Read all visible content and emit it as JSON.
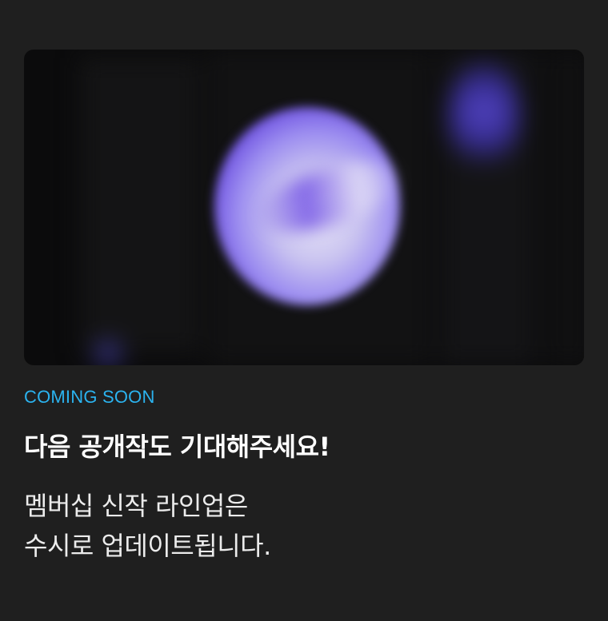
{
  "badge": {
    "label": "COMING SOON",
    "color": "#2bb3ef"
  },
  "headline": "다음 공개작도 기대해주세요!",
  "description": {
    "line1": "멤버십 신작 라인업은",
    "line2": "수시로 업데이트됩니다."
  },
  "preview": {
    "description_icon": "blurred-artwork-image",
    "accent_color": "#6c4fe0"
  },
  "colors": {
    "background": "#1f1f1f",
    "text_primary": "#ffffff",
    "text_secondary": "#ececec"
  }
}
